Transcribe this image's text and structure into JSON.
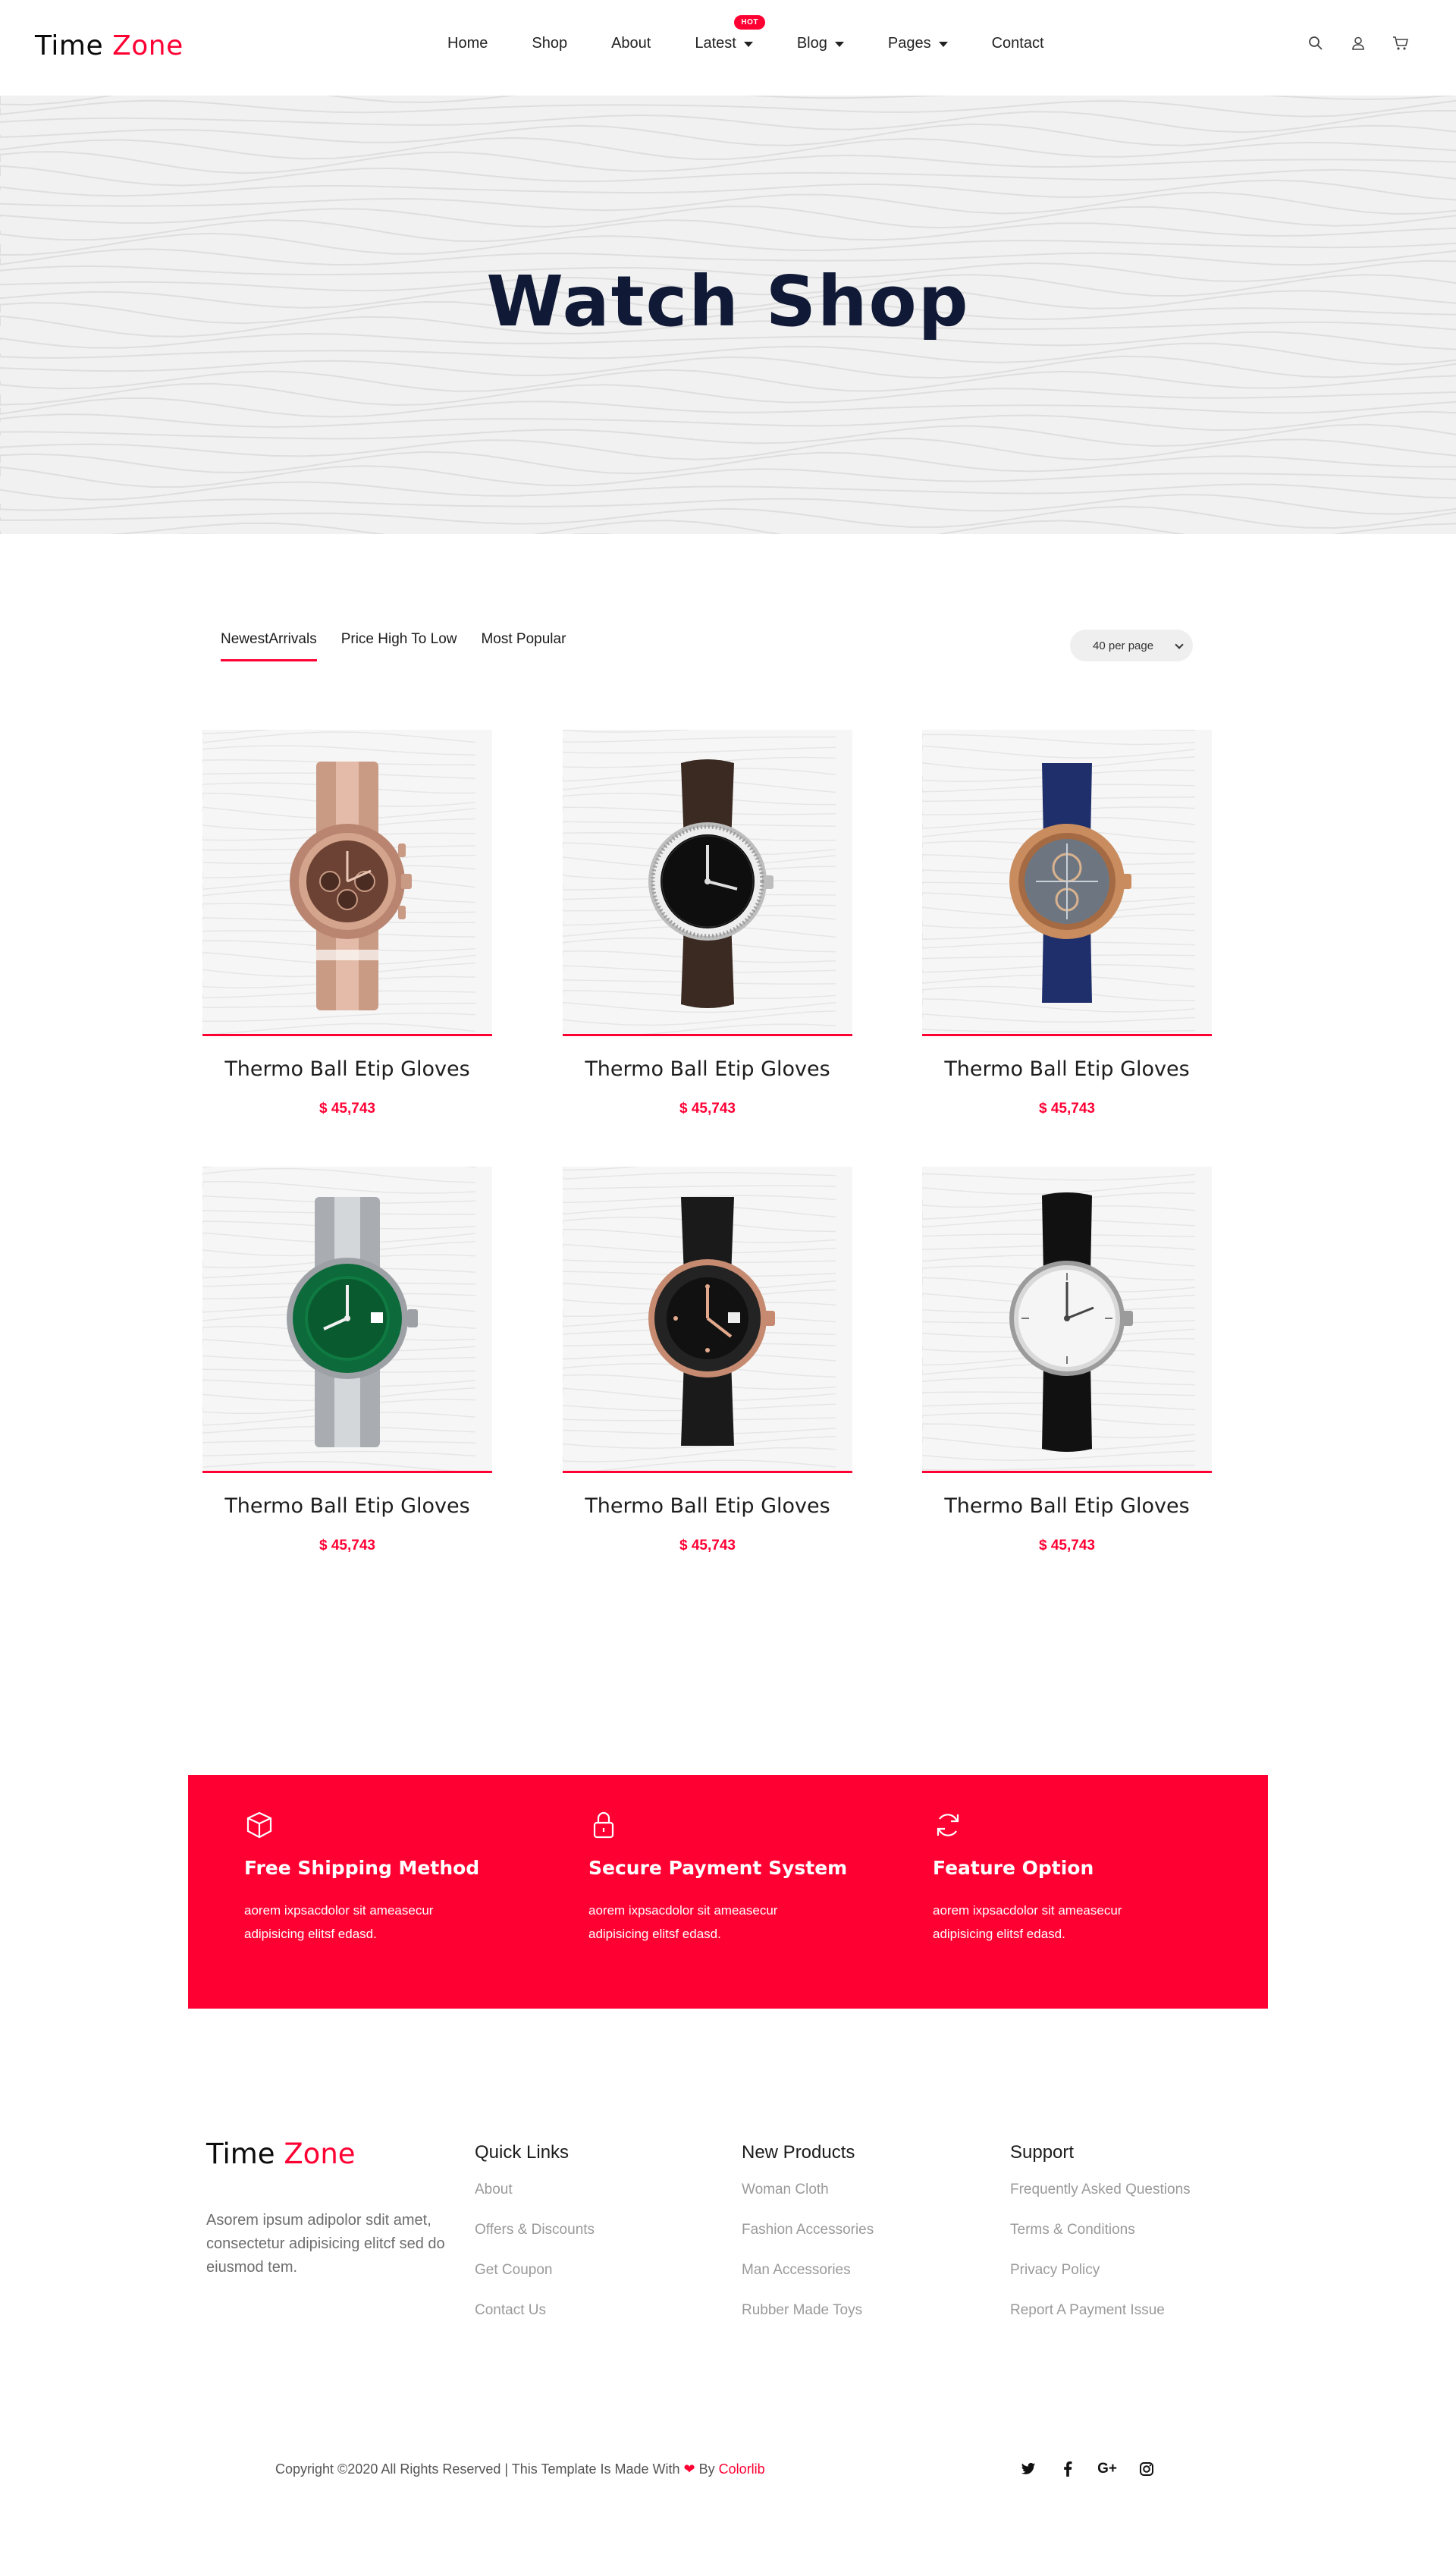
{
  "header": {
    "logo_main": "Time",
    "logo_accent": "Zone",
    "nav": [
      {
        "label": "Home"
      },
      {
        "label": "Shop"
      },
      {
        "label": "About"
      },
      {
        "label": "Latest",
        "badge": "HOT"
      },
      {
        "label": "Blog"
      },
      {
        "label": "Pages"
      },
      {
        "label": "Contact"
      }
    ],
    "icons": [
      "search-icon",
      "user-icon",
      "cart-icon"
    ]
  },
  "hero": {
    "title": "Watch Shop"
  },
  "sort": {
    "tabs": [
      "NewestArrivals",
      "Price High To Low",
      "Most Popular"
    ],
    "active_tab": "NewestArrivals",
    "per_page": "40 per page"
  },
  "products": [
    {
      "name": "Thermo Ball Etip Gloves",
      "price": "$ 45,743",
      "watch": "rose-gold-chronograph"
    },
    {
      "name": "Thermo Ball Etip Gloves",
      "price": "$ 45,743",
      "watch": "diamond-black-dial"
    },
    {
      "name": "Thermo Ball Etip Gloves",
      "price": "$ 45,743",
      "watch": "skeleton-blue-strap"
    },
    {
      "name": "Thermo Ball Etip Gloves",
      "price": "$ 45,743",
      "watch": "green-submariner"
    },
    {
      "name": "Thermo Ball Etip Gloves",
      "price": "$ 45,743",
      "watch": "black-rubber-rose"
    },
    {
      "name": "Thermo Ball Etip Gloves",
      "price": "$ 45,743",
      "watch": "white-dial-leather"
    }
  ],
  "features": [
    {
      "icon": "box-icon",
      "title": "Free Shipping Method",
      "text_line1": "aorem ixpsacdolor sit ameasecur",
      "text_line2": "adipisicing elitsf edasd."
    },
    {
      "icon": "lock-icon",
      "title": "Secure Payment System",
      "text_line1": "aorem ixpsacdolor sit ameasecur",
      "text_line2": "adipisicing elitsf edasd."
    },
    {
      "icon": "refresh-icon",
      "title": "Feature Option",
      "text_line1": "aorem ixpsacdolor sit ameasecur",
      "text_line2": "adipisicing elitsf edasd."
    }
  ],
  "footer": {
    "logo_main": "Time",
    "logo_accent": "Zone",
    "description": "Asorem ipsum adipolor sdit amet, consectetur adipisicing elitcf sed do eiusmod tem.",
    "columns": [
      {
        "heading": "Quick Links",
        "links": [
          "About",
          "Offers & Discounts",
          "Get Coupon",
          "Contact Us"
        ]
      },
      {
        "heading": "New Products",
        "links": [
          "Woman Cloth",
          "Fashion Accessories",
          "Man Accessories",
          "Rubber Made Toys"
        ]
      },
      {
        "heading": "Support",
        "links": [
          "Frequently Asked Questions",
          "Terms & Conditions",
          "Privacy Policy",
          "Report A Payment Issue"
        ]
      }
    ],
    "copyright_prefix": "Copyright ©2020 All Rights Reserved | This Template Is Made With",
    "copyright_by": "By",
    "copyright_brand": "Colorlib",
    "socials": [
      {
        "icon": "twitter-icon",
        "glyph": "t"
      },
      {
        "icon": "facebook-icon",
        "glyph": "f"
      },
      {
        "icon": "google-plus-icon",
        "glyph": "G+"
      },
      {
        "icon": "instagram-icon",
        "glyph": ""
      }
    ]
  },
  "colors": {
    "accent": "#ff0033",
    "heading_dark": "#101935",
    "hero_bg": "#f1f1f1",
    "product_bg": "#f6f6f6"
  }
}
